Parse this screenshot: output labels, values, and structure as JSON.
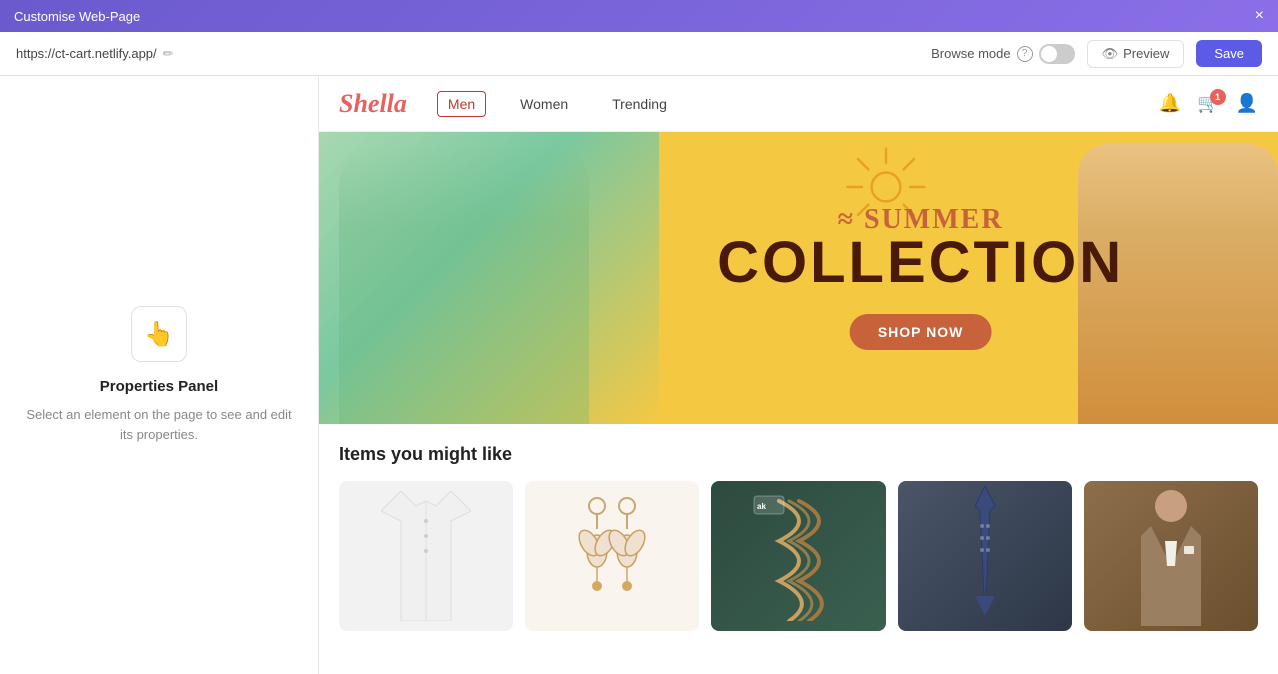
{
  "titleBar": {
    "title": "Customise Web-Page",
    "closeLabel": "×"
  },
  "toolbar": {
    "url": "https://ct-cart.netlify.app/",
    "editIconLabel": "✏",
    "browseModeLabel": "Browse mode",
    "browseInfoLabel": "?",
    "previewLabel": "Preview",
    "saveLabel": "Save"
  },
  "leftPanel": {
    "iconEmoji": "👆",
    "title": "Properties Panel",
    "description": "Select an element on the page to see and edit its properties."
  },
  "storeNav": {
    "logo": "Shella",
    "items": [
      {
        "label": "Men",
        "active": true
      },
      {
        "label": "Women",
        "active": false
      },
      {
        "label": "Trending",
        "active": false
      }
    ],
    "cartCount": "1"
  },
  "heroBanner": {
    "summerText": "~Summer",
    "collectionText": "COLLECTION",
    "shopNowLabel": "SHOP NOW"
  },
  "itemsSection": {
    "title": "Items you might like",
    "products": [
      {
        "id": "shirt",
        "type": "shirt"
      },
      {
        "id": "earrings",
        "type": "earrings"
      },
      {
        "id": "rope",
        "type": "rope"
      },
      {
        "id": "tie",
        "type": "tie"
      },
      {
        "id": "suit",
        "type": "suit"
      }
    ]
  }
}
